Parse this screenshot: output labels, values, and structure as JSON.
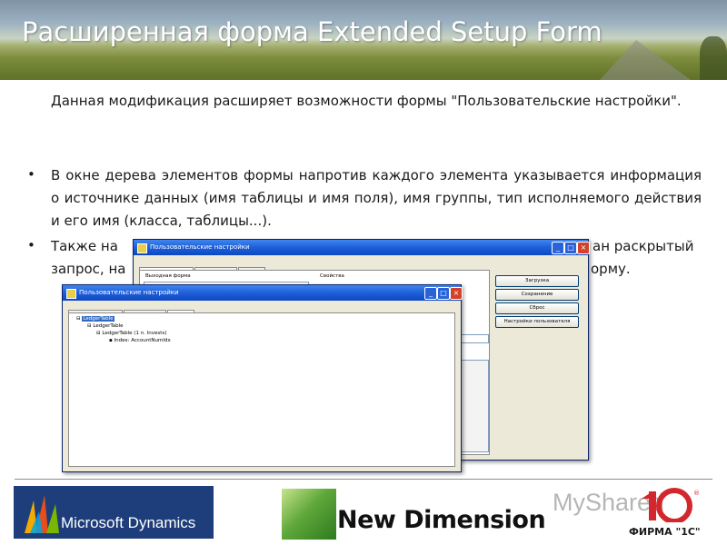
{
  "slide": {
    "title": "Расширенная форма Extended Setup Form",
    "paragraph1": "Данная модификация расширяет возможности формы \"Пользовательские настройки\".",
    "bullet1": "В окне дерева элементов формы напротив каждого элемента указывается информация о источнике данных (имя таблицы и имя поля), имя группы, тип исполняемого действия и его имя (класса, таблицы...).",
    "bullet2_line1_start": "Также на",
    "bullet2_line1_end": "ан раскрытый",
    "bullet2_line2_start": "запрос, на",
    "bullet2_line2_end": "орму."
  },
  "window_back": {
    "title": "Пользовательские настройки",
    "tabs": [
      "Выходная форма",
      "Информация",
      "Запрос"
    ],
    "group_left": "Выходная форма",
    "group_right": "Свойства",
    "buttons": [
      "Загрузка",
      "Сохранение",
      "Сброс",
      "Настройки пользователя"
    ]
  },
  "window_front": {
    "title": "Пользовательские настройки",
    "tabs": [
      "Выходная форма",
      "Информация",
      "Запрос"
    ],
    "tree": [
      "LedgerTable",
      "LedgerTable",
      "LedgerTable (1 n. Invests)",
      "Index: AccountNumIdx"
    ]
  },
  "footer": {
    "ms_logo": "Microsoft Dynamics",
    "nd_text": "New Dimension",
    "onec_logo": "1С",
    "onec_caption": "ФИРМА \"1С\"",
    "watermark": "MyShared"
  },
  "colors": {
    "titlebar": "#1e5fd8",
    "ms_blue": "#1d3e7a",
    "onec_red": "#d3272d"
  }
}
